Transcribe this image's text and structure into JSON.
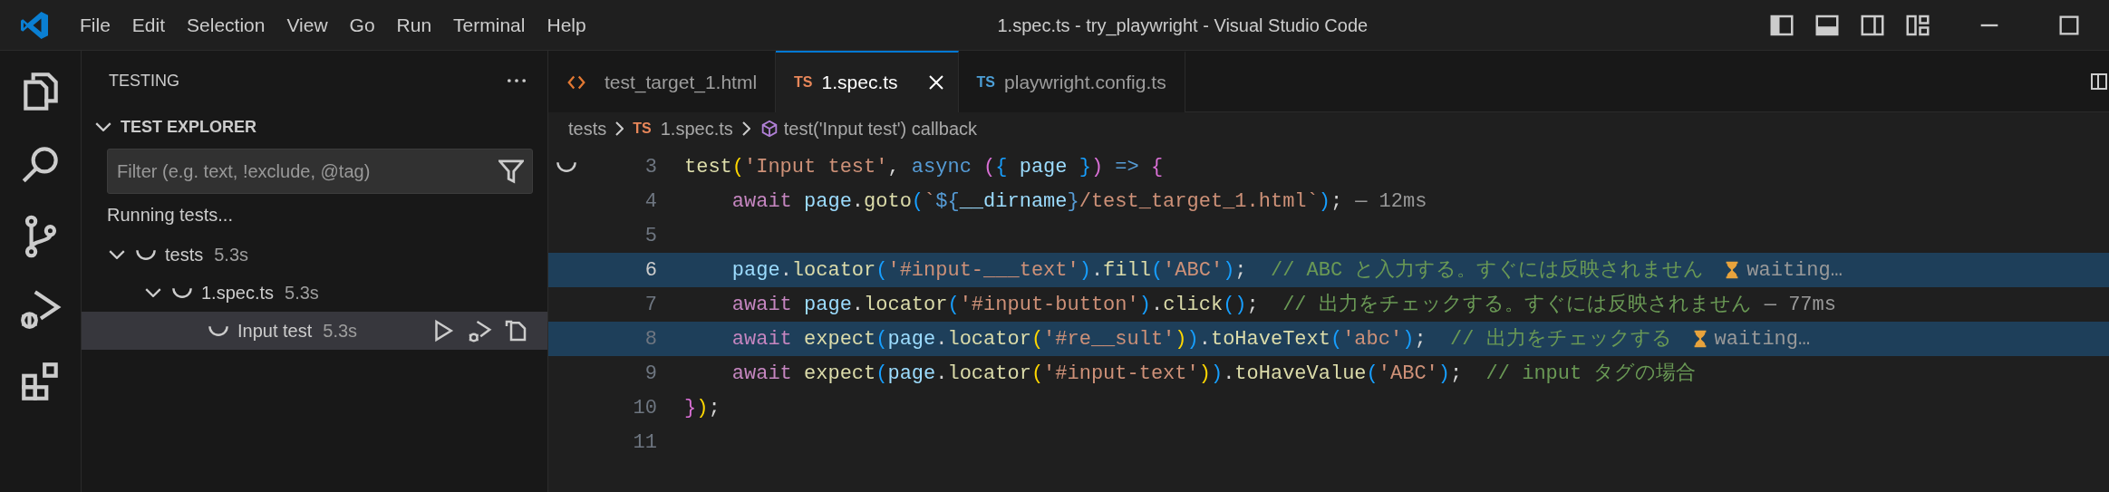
{
  "title_bar": {
    "menu": [
      "File",
      "Edit",
      "Selection",
      "View",
      "Go",
      "Run",
      "Terminal",
      "Help"
    ],
    "title": "1.spec.ts - try_playwright - Visual Studio Code"
  },
  "sidebar": {
    "title": "TESTING",
    "section": {
      "title": "TEST EXPLORER",
      "expanded": true
    },
    "filter": {
      "placeholder": "Filter (e.g. text, !exclude, @tag)"
    },
    "status": "Running tests...",
    "tree": [
      {
        "label": "tests",
        "duration": "5.3s",
        "running": true,
        "expanded": true,
        "selected": false,
        "children": [
          {
            "label": "1.spec.ts",
            "duration": "5.3s",
            "running": true,
            "expanded": true,
            "selected": false,
            "children": [
              {
                "label": "Input test",
                "duration": "5.3s",
                "running": true,
                "selected": true
              }
            ]
          }
        ]
      }
    ]
  },
  "editor": {
    "tabs": [
      {
        "label": "test_target_1.html",
        "kind": "html",
        "selected": false
      },
      {
        "label": "1.spec.ts",
        "kind": "ts",
        "badge": "TS",
        "selected": true
      },
      {
        "label": "playwright.config.ts",
        "kind": "ts",
        "badge": "TS",
        "selected": false
      }
    ],
    "breadcrumbs": [
      {
        "kind": "folder",
        "text": "tests"
      },
      {
        "kind": "file",
        "badge": "TS",
        "text": "1.spec.ts"
      },
      {
        "kind": "symbol",
        "text": "test('Input test') callback"
      }
    ],
    "lines": [
      {
        "number": "3",
        "active": false,
        "highlighted": false,
        "running": true,
        "tokens": [
          {
            "text": "test",
            "kind": "fn"
          },
          {
            "text": "(",
            "kind": "b1"
          },
          {
            "text": "'Input test'",
            "kind": "str"
          },
          {
            "text": ", ",
            "kind": "p"
          },
          {
            "text": "async ",
            "kind": "sto"
          },
          {
            "text": "(",
            "kind": "b2"
          },
          {
            "text": "{",
            "kind": "b3"
          },
          {
            "text": " page ",
            "kind": "var"
          },
          {
            "text": "}",
            "kind": "b3"
          },
          {
            "text": ")",
            "kind": "b2"
          },
          {
            "text": " => ",
            "kind": "sto"
          },
          {
            "text": "{",
            "kind": "b2"
          }
        ]
      },
      {
        "number": "4",
        "active": false,
        "highlighted": false,
        "running": false,
        "tokens": [
          {
            "text": "    await",
            "kind": "kw"
          },
          {
            "text": " page",
            "kind": "var"
          },
          {
            "text": ".",
            "kind": "p"
          },
          {
            "text": "goto",
            "kind": "fn"
          },
          {
            "text": "(",
            "kind": "b3"
          },
          {
            "text": "`",
            "kind": "str"
          },
          {
            "text": "${",
            "kind": "sto"
          },
          {
            "text": "__dirname",
            "kind": "var"
          },
          {
            "text": "}",
            "kind": "sto"
          },
          {
            "text": "/test_target_1.html`",
            "kind": "str"
          },
          {
            "text": ")",
            "kind": "b3"
          },
          {
            "text": ";",
            "kind": "p"
          }
        ],
        "annotation": {
          "kind": "duration",
          "text": "— 12ms"
        }
      },
      {
        "number": "5",
        "active": false,
        "highlighted": false,
        "running": false
      },
      {
        "number": "6",
        "active": true,
        "highlighted": true,
        "running": false,
        "tokens": [
          {
            "text": "    page",
            "kind": "var"
          },
          {
            "text": ".",
            "kind": "p"
          },
          {
            "text": "locator",
            "kind": "fn"
          },
          {
            "text": "(",
            "kind": "b3"
          },
          {
            "text": "'#input-___text'",
            "kind": "str"
          },
          {
            "text": ")",
            "kind": "b3"
          },
          {
            "text": ".",
            "kind": "p"
          },
          {
            "text": "fill",
            "kind": "fn"
          },
          {
            "text": "(",
            "kind": "b3"
          },
          {
            "text": "'ABC'",
            "kind": "str"
          },
          {
            "text": ")",
            "kind": "b3"
          },
          {
            "text": ";",
            "kind": "p"
          },
          {
            "text": "  // ABC と入力する。すぐには反映されません",
            "kind": "cm"
          }
        ],
        "annotation": {
          "kind": "waiting",
          "text": "waiting…"
        }
      },
      {
        "number": "7",
        "active": false,
        "highlighted": false,
        "running": false,
        "tokens": [
          {
            "text": "    await",
            "kind": "kw"
          },
          {
            "text": " page",
            "kind": "var"
          },
          {
            "text": ".",
            "kind": "p"
          },
          {
            "text": "locator",
            "kind": "fn"
          },
          {
            "text": "(",
            "kind": "b3"
          },
          {
            "text": "'#input-button'",
            "kind": "str"
          },
          {
            "text": ")",
            "kind": "b3"
          },
          {
            "text": ".",
            "kind": "p"
          },
          {
            "text": "click",
            "kind": "fn"
          },
          {
            "text": "()",
            "kind": "b3"
          },
          {
            "text": ";",
            "kind": "p"
          },
          {
            "text": "  // 出力をチェックする。すぐには反映されません",
            "kind": "cm"
          }
        ],
        "annotation": {
          "kind": "duration",
          "text": "— 77ms"
        }
      },
      {
        "number": "8",
        "active": false,
        "highlighted": true,
        "running": false,
        "tokens": [
          {
            "text": "    await ",
            "kind": "kw"
          },
          {
            "text": "expect",
            "kind": "fn"
          },
          {
            "text": "(",
            "kind": "b3"
          },
          {
            "text": "page",
            "kind": "var"
          },
          {
            "text": ".",
            "kind": "p"
          },
          {
            "text": "locator",
            "kind": "fn"
          },
          {
            "text": "(",
            "kind": "b1"
          },
          {
            "text": "'#re__sult'",
            "kind": "str"
          },
          {
            "text": ")",
            "kind": "b1"
          },
          {
            "text": ")",
            "kind": "b3"
          },
          {
            "text": ".",
            "kind": "p"
          },
          {
            "text": "toHaveText",
            "kind": "fn"
          },
          {
            "text": "(",
            "kind": "b3"
          },
          {
            "text": "'abc'",
            "kind": "str"
          },
          {
            "text": ")",
            "kind": "b3"
          },
          {
            "text": ";",
            "kind": "p"
          },
          {
            "text": "  // 出力をチェックする",
            "kind": "cm"
          }
        ],
        "annotation": {
          "kind": "waiting",
          "text": "waiting…"
        }
      },
      {
        "number": "9",
        "active": false,
        "highlighted": false,
        "running": false,
        "tokens": [
          {
            "text": "    await ",
            "kind": "kw"
          },
          {
            "text": "expect",
            "kind": "fn"
          },
          {
            "text": "(",
            "kind": "b3"
          },
          {
            "text": "page",
            "kind": "var"
          },
          {
            "text": ".",
            "kind": "p"
          },
          {
            "text": "locator",
            "kind": "fn"
          },
          {
            "text": "(",
            "kind": "b1"
          },
          {
            "text": "'#input-text'",
            "kind": "str"
          },
          {
            "text": ")",
            "kind": "b1"
          },
          {
            "text": ")",
            "kind": "b3"
          },
          {
            "text": ".",
            "kind": "p"
          },
          {
            "text": "toHaveValue",
            "kind": "fn"
          },
          {
            "text": "(",
            "kind": "b3"
          },
          {
            "text": "'ABC'",
            "kind": "str"
          },
          {
            "text": ")",
            "kind": "b3"
          },
          {
            "text": ";",
            "kind": "p"
          },
          {
            "text": "  // input タグの場合",
            "kind": "cm"
          }
        ]
      },
      {
        "number": "10",
        "active": false,
        "highlighted": false,
        "running": false,
        "tokens": [
          {
            "text": "}",
            "kind": "b2"
          },
          {
            "text": ")",
            "kind": "b1"
          },
          {
            "text": ";",
            "kind": "p"
          }
        ]
      },
      {
        "number": "11",
        "active": false,
        "highlighted": false,
        "running": false
      }
    ]
  }
}
